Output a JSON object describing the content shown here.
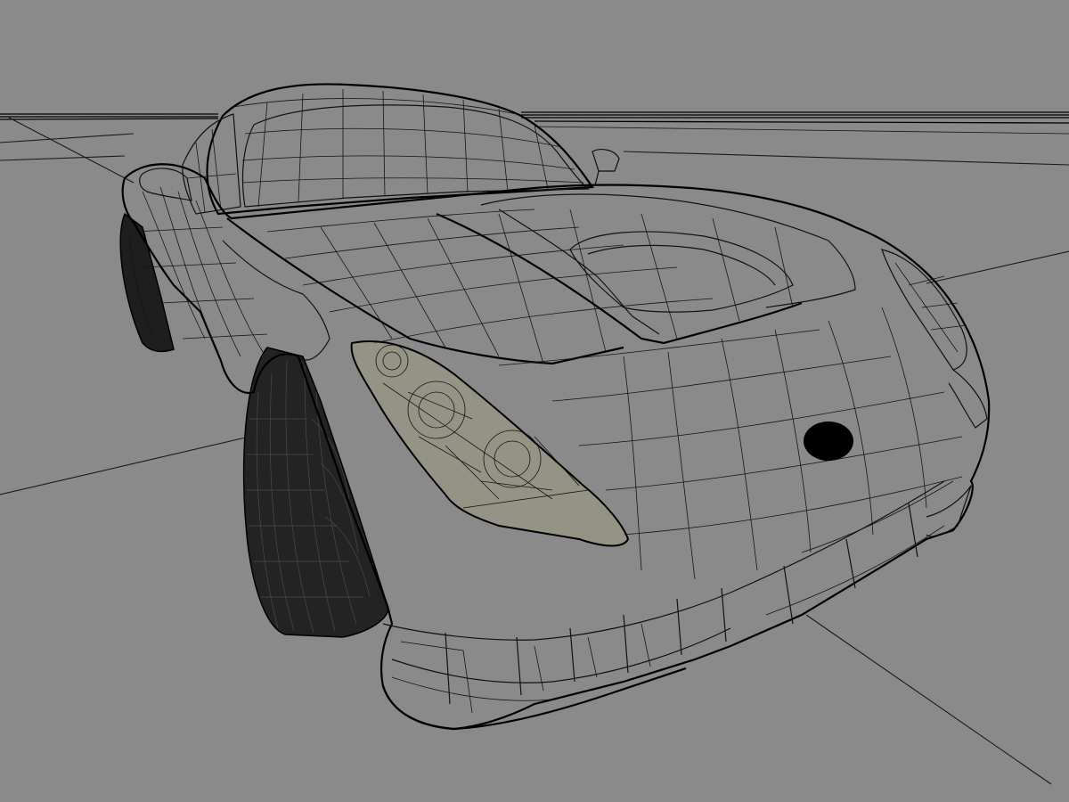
{
  "viewport": {
    "background_color": "#8a8a8a",
    "wire_color": "#111111",
    "headlight_tint": "#9a9a7a",
    "tire_color": "#1e1e1e",
    "badge_color": "#000000"
  },
  "scene": {
    "subject": "car-wireframe-model",
    "shading": "wireframe"
  }
}
